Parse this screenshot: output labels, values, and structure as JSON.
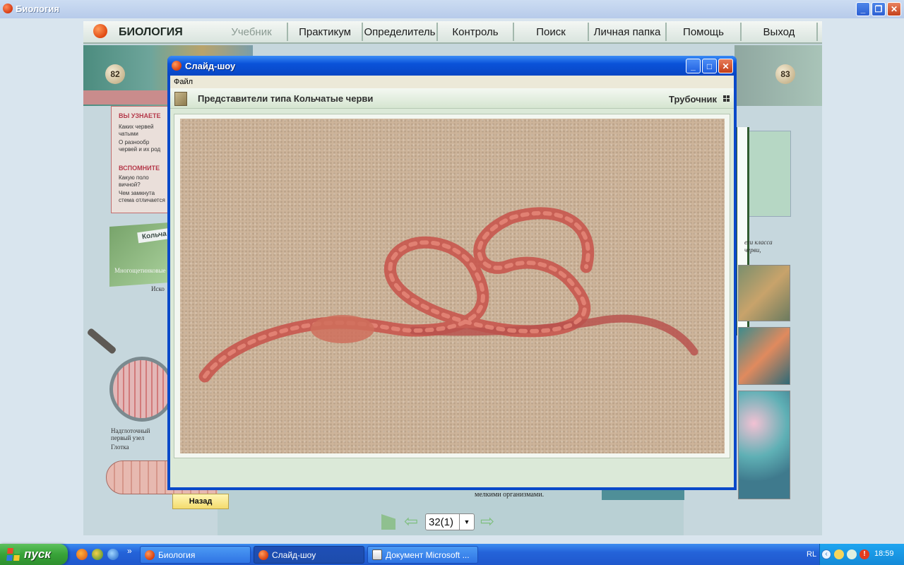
{
  "window": {
    "title": "Биология"
  },
  "app": {
    "brand": "БИОЛОГИЯ",
    "nav": [
      {
        "label": "Учебник",
        "disabled": true
      },
      {
        "label": "Практикум"
      },
      {
        "label": "Определитель"
      },
      {
        "label": "Контроль"
      },
      {
        "label": "Поиск"
      },
      {
        "label": "Личная папка"
      },
      {
        "label": "Помощь"
      },
      {
        "label": "Выход"
      }
    ]
  },
  "book": {
    "left_page_number": "82",
    "right_page_number": "83",
    "learn_heading": "ВЫ УЗНАЕТЕ",
    "learn_lines": [
      "Каких червей",
      "чатыми",
      "О разнообр",
      "червей и их род"
    ],
    "recall_heading": "ВСПОМНИТЕ",
    "recall_lines": [
      "Какую поло",
      "вичной?",
      "Чем замкнута",
      "стема отличается"
    ],
    "card_label": "Кольча",
    "card_small_1": "Многощетинковые",
    "card_small_2": "Иско",
    "caption_1": "Надглоточный",
    "caption_2": "первый узел",
    "caption_3": "Глотка",
    "right_caption_1": "ели класса",
    "right_caption_2": "черви,",
    "bottom_text": "мелкими организмами."
  },
  "pager": {
    "value": "32(1)"
  },
  "slideshow": {
    "title": "Слайд-шоу",
    "menu_file": "Файл",
    "slide_title": "Представители типа Кольчатые черви",
    "slide_subtitle": "Трубочник",
    "back_label": "Назад"
  },
  "taskbar": {
    "start_label": "пуск",
    "tasks": [
      {
        "label": "Биология"
      },
      {
        "label": "Слайд-шоу"
      },
      {
        "label": "Документ Microsoft ..."
      }
    ],
    "language": "RL",
    "clock": "18:59"
  },
  "colors": {
    "xp_blue": "#0a49c9",
    "start_green": "#38a338",
    "worm_red": "#c8574e",
    "sand": "#cdb49a"
  }
}
